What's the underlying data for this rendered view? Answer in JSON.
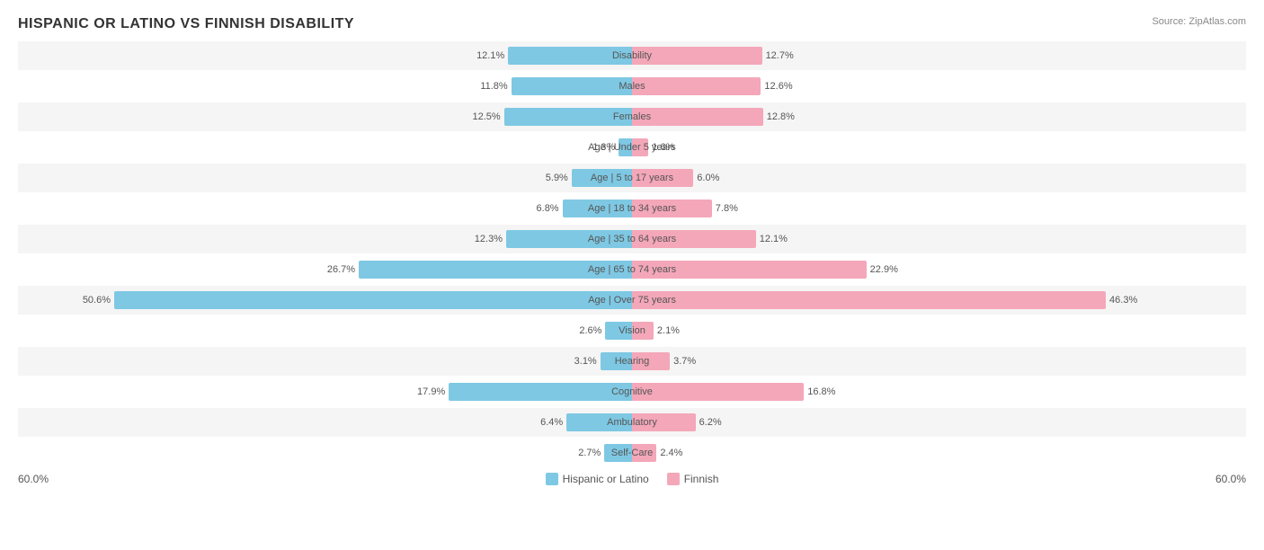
{
  "title": "HISPANIC OR LATINO VS FINNISH DISABILITY",
  "source": "Source: ZipAtlas.com",
  "footer": {
    "left": "60.0%",
    "right": "60.0%"
  },
  "legend": {
    "items": [
      {
        "label": "Hispanic or Latino",
        "color": "#7ec8e3"
      },
      {
        "label": "Finnish",
        "color": "#f4a7b9"
      }
    ]
  },
  "rows": [
    {
      "label": "Disability",
      "left_val": "12.1%",
      "right_val": "12.7%",
      "left_pct": 12.1,
      "right_pct": 12.7
    },
    {
      "label": "Males",
      "left_val": "11.8%",
      "right_val": "12.6%",
      "left_pct": 11.8,
      "right_pct": 12.6
    },
    {
      "label": "Females",
      "left_val": "12.5%",
      "right_val": "12.8%",
      "left_pct": 12.5,
      "right_pct": 12.8
    },
    {
      "label": "Age | Under 5 years",
      "left_val": "1.3%",
      "right_val": "1.6%",
      "left_pct": 1.3,
      "right_pct": 1.6
    },
    {
      "label": "Age | 5 to 17 years",
      "left_val": "5.9%",
      "right_val": "6.0%",
      "left_pct": 5.9,
      "right_pct": 6.0
    },
    {
      "label": "Age | 18 to 34 years",
      "left_val": "6.8%",
      "right_val": "7.8%",
      "left_pct": 6.8,
      "right_pct": 7.8
    },
    {
      "label": "Age | 35 to 64 years",
      "left_val": "12.3%",
      "right_val": "12.1%",
      "left_pct": 12.3,
      "right_pct": 12.1
    },
    {
      "label": "Age | 65 to 74 years",
      "left_val": "26.7%",
      "right_val": "22.9%",
      "left_pct": 26.7,
      "right_pct": 22.9
    },
    {
      "label": "Age | Over 75 years",
      "left_val": "50.6%",
      "right_val": "46.3%",
      "left_pct": 50.6,
      "right_pct": 46.3
    },
    {
      "label": "Vision",
      "left_val": "2.6%",
      "right_val": "2.1%",
      "left_pct": 2.6,
      "right_pct": 2.1
    },
    {
      "label": "Hearing",
      "left_val": "3.1%",
      "right_val": "3.7%",
      "left_pct": 3.1,
      "right_pct": 3.7
    },
    {
      "label": "Cognitive",
      "left_val": "17.9%",
      "right_val": "16.8%",
      "left_pct": 17.9,
      "right_pct": 16.8
    },
    {
      "label": "Ambulatory",
      "left_val": "6.4%",
      "right_val": "6.2%",
      "left_pct": 6.4,
      "right_pct": 6.2
    },
    {
      "label": "Self-Care",
      "left_val": "2.7%",
      "right_val": "2.4%",
      "left_pct": 2.7,
      "right_pct": 2.4
    }
  ],
  "max_pct": 60
}
